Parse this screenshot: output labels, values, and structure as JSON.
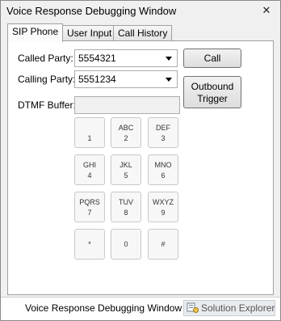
{
  "window": {
    "title": "Voice Response Debugging Window",
    "close_glyph": "✕"
  },
  "tabs": [
    {
      "label": "SIP Phone",
      "active": true
    },
    {
      "label": "User Input",
      "active": false
    },
    {
      "label": "Call History",
      "active": false
    }
  ],
  "sip_phone": {
    "called_party_label": "Called Party:",
    "called_party_value": "5554321",
    "calling_party_label": "Calling Party:",
    "calling_party_value": "5551234",
    "dtmf_label": "DTMF Buffer:",
    "dtmf_value": "",
    "call_button": "Call",
    "outbound_line1": "Outbound",
    "outbound_line2": "Trigger"
  },
  "keypad": [
    {
      "digit": "1",
      "letters": ""
    },
    {
      "digit": "2",
      "letters": "ABC"
    },
    {
      "digit": "3",
      "letters": "DEF"
    },
    {
      "digit": "4",
      "letters": "GHI"
    },
    {
      "digit": "5",
      "letters": "JKL"
    },
    {
      "digit": "6",
      "letters": "MNO"
    },
    {
      "digit": "7",
      "letters": "PQRS"
    },
    {
      "digit": "8",
      "letters": "TUV"
    },
    {
      "digit": "9",
      "letters": "WXYZ"
    },
    {
      "digit": "*",
      "letters": ""
    },
    {
      "digit": "0",
      "letters": ""
    },
    {
      "digit": "#",
      "letters": ""
    }
  ],
  "status": {
    "active_window": "Voice Response Debugging Window",
    "other_window": "Solution Explorer",
    "other_window_icon": "solution-explorer-icon"
  }
}
